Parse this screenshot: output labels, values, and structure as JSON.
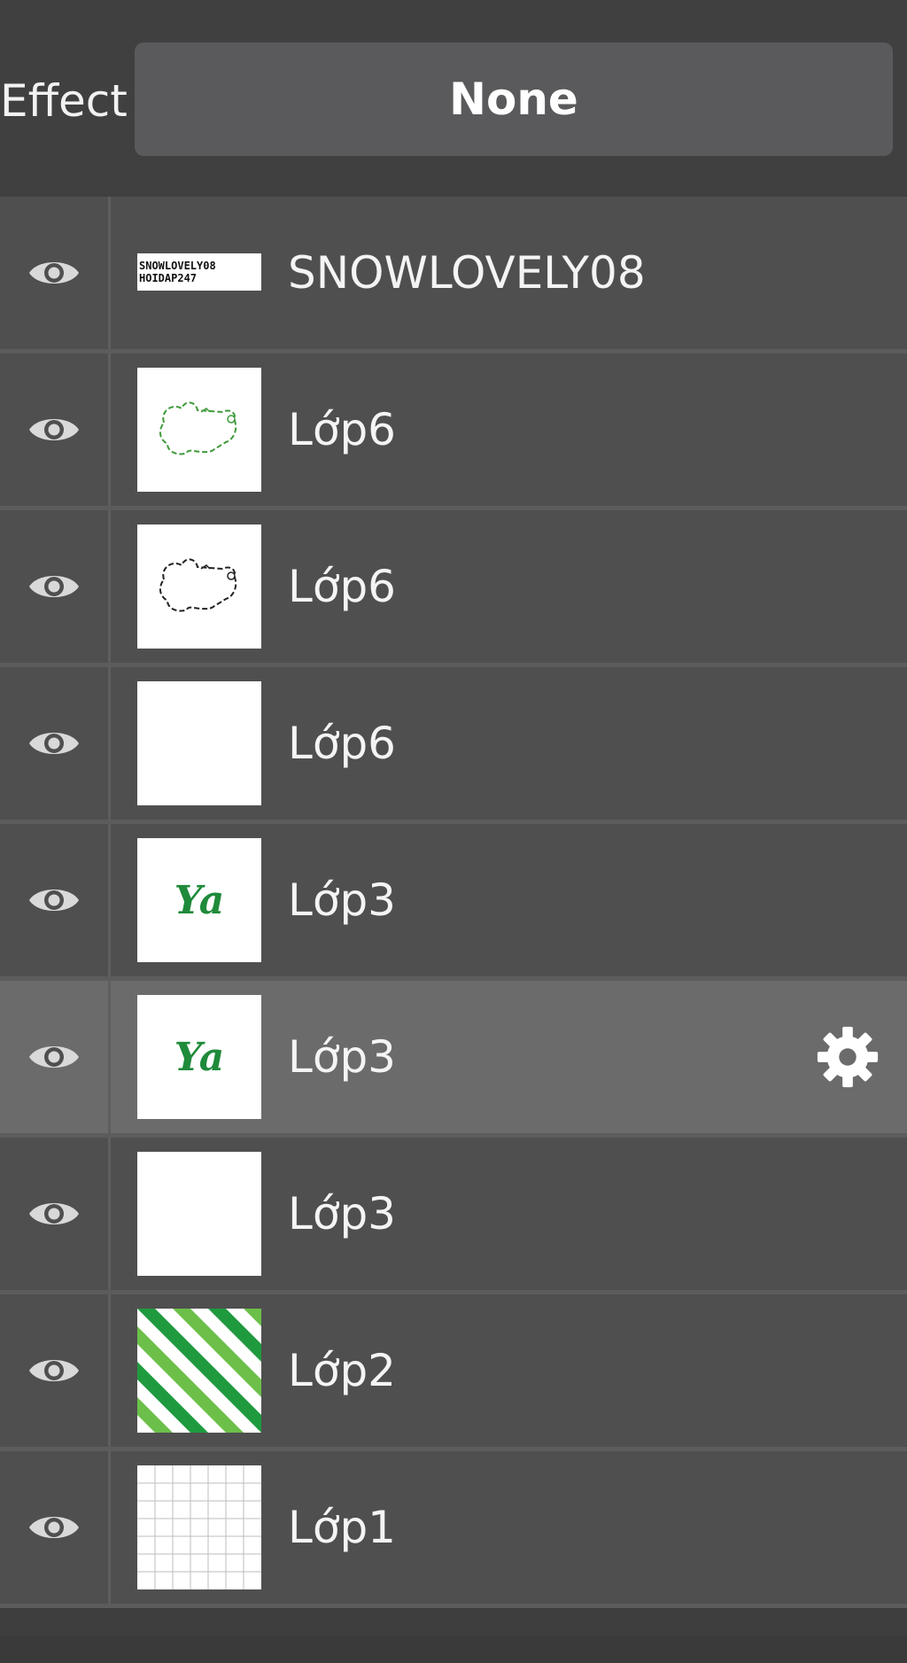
{
  "effect": {
    "label": "Effect",
    "value": "None"
  },
  "layers": [
    {
      "name": "SNOWLOVELY08",
      "thumb": "text-banner",
      "thumb_text": [
        "SNOWLOVELY08",
        "HOIDAP247"
      ],
      "visible": true,
      "selected": false
    },
    {
      "name": "Lớp6",
      "thumb": "green-outline-doodle",
      "visible": true,
      "selected": false
    },
    {
      "name": "Lớp6",
      "thumb": "black-outline-doodle",
      "visible": true,
      "selected": false
    },
    {
      "name": "Lớp6",
      "thumb": "blank",
      "visible": true,
      "selected": false
    },
    {
      "name": "Lớp3",
      "thumb": "ya-text",
      "thumb_text": "Ya",
      "visible": true,
      "selected": false
    },
    {
      "name": "Lớp3",
      "thumb": "ya-text",
      "thumb_text": "Ya",
      "visible": true,
      "selected": true
    },
    {
      "name": "Lớp3",
      "thumb": "blank",
      "visible": true,
      "selected": false
    },
    {
      "name": "Lớp2",
      "thumb": "green-stripes",
      "visible": true,
      "selected": false
    },
    {
      "name": "Lớp1",
      "thumb": "grid",
      "visible": true,
      "selected": false
    }
  ],
  "icons": {
    "visibility": "eye-icon",
    "settings": "gear-icon"
  },
  "colors": {
    "background": "#3e3e3f",
    "row": "#4f4f4f",
    "row_selected": "#6b6b6b",
    "green_dark": "#1f8a3a",
    "green_light": "#4db84a"
  }
}
